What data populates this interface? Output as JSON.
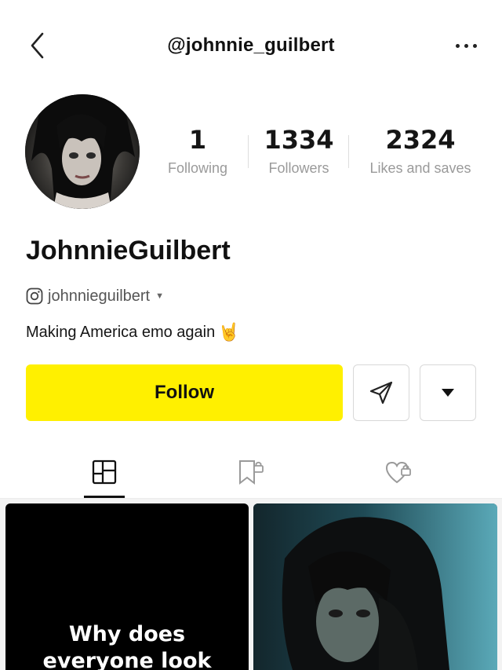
{
  "header": {
    "handle": "@johnnie_guilbert"
  },
  "profile": {
    "avatar_icon": "profile-photo",
    "display_name": "JohnnieGuilbert",
    "instagram_handle": "johnnieguilbert",
    "bio": "Making America emo again",
    "bio_emoji": "🤘"
  },
  "stats": [
    {
      "value": "1",
      "label": "Following"
    },
    {
      "value": "1334",
      "label": "Followers"
    },
    {
      "value": "2324",
      "label": "Likes and saves"
    }
  ],
  "actions": {
    "follow_label": "Follow",
    "accent_color": "#fff000"
  },
  "tabs": {
    "active_index": 0,
    "items": [
      "notes-grid-icon",
      "saved-locked-icon",
      "liked-locked-icon"
    ]
  },
  "posts": [
    {
      "caption": "Why does everyone look",
      "background": "#000000"
    },
    {
      "caption": "",
      "background": "#1c3d46"
    }
  ]
}
